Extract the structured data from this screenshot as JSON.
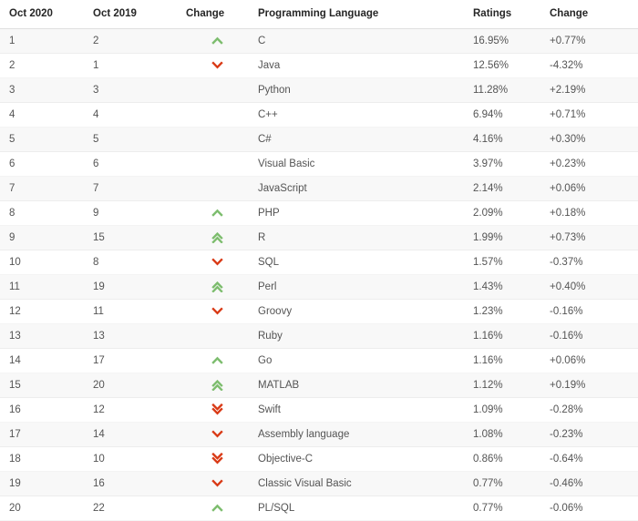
{
  "table": {
    "columns": [
      {
        "key": "rank_new",
        "label": "Oct 2020"
      },
      {
        "key": "rank_old",
        "label": "Oct 2019"
      },
      {
        "key": "change",
        "label": "Change"
      },
      {
        "key": "language",
        "label": "Programming Language"
      },
      {
        "key": "ratings",
        "label": "Ratings"
      },
      {
        "key": "delta",
        "label": "Change"
      }
    ],
    "colors": {
      "up": "#7dbd6e",
      "down": "#d93a16",
      "row_odd": "#f8f8f8",
      "row_even": "#ffffff",
      "header_text": "#262626",
      "body_text": "#545454",
      "border": "#e0e0e0"
    },
    "rows": [
      {
        "rank_new": "1",
        "rank_old": "2",
        "change": "up",
        "language": "C",
        "ratings": "16.95%",
        "delta": "+0.77%"
      },
      {
        "rank_new": "2",
        "rank_old": "1",
        "change": "down",
        "language": "Java",
        "ratings": "12.56%",
        "delta": "-4.32%"
      },
      {
        "rank_new": "3",
        "rank_old": "3",
        "change": "none",
        "language": "Python",
        "ratings": "11.28%",
        "delta": "+2.19%"
      },
      {
        "rank_new": "4",
        "rank_old": "4",
        "change": "none",
        "language": "C++",
        "ratings": "6.94%",
        "delta": "+0.71%"
      },
      {
        "rank_new": "5",
        "rank_old": "5",
        "change": "none",
        "language": "C#",
        "ratings": "4.16%",
        "delta": "+0.30%"
      },
      {
        "rank_new": "6",
        "rank_old": "6",
        "change": "none",
        "language": "Visual Basic",
        "ratings": "3.97%",
        "delta": "+0.23%"
      },
      {
        "rank_new": "7",
        "rank_old": "7",
        "change": "none",
        "language": "JavaScript",
        "ratings": "2.14%",
        "delta": "+0.06%"
      },
      {
        "rank_new": "8",
        "rank_old": "9",
        "change": "up",
        "language": "PHP",
        "ratings": "2.09%",
        "delta": "+0.18%"
      },
      {
        "rank_new": "9",
        "rank_old": "15",
        "change": "up-double",
        "language": "R",
        "ratings": "1.99%",
        "delta": "+0.73%"
      },
      {
        "rank_new": "10",
        "rank_old": "8",
        "change": "down",
        "language": "SQL",
        "ratings": "1.57%",
        "delta": "-0.37%"
      },
      {
        "rank_new": "11",
        "rank_old": "19",
        "change": "up-double",
        "language": "Perl",
        "ratings": "1.43%",
        "delta": "+0.40%"
      },
      {
        "rank_new": "12",
        "rank_old": "11",
        "change": "down",
        "language": "Groovy",
        "ratings": "1.23%",
        "delta": "-0.16%"
      },
      {
        "rank_new": "13",
        "rank_old": "13",
        "change": "none",
        "language": "Ruby",
        "ratings": "1.16%",
        "delta": "-0.16%"
      },
      {
        "rank_new": "14",
        "rank_old": "17",
        "change": "up",
        "language": "Go",
        "ratings": "1.16%",
        "delta": "+0.06%"
      },
      {
        "rank_new": "15",
        "rank_old": "20",
        "change": "up-double",
        "language": "MATLAB",
        "ratings": "1.12%",
        "delta": "+0.19%"
      },
      {
        "rank_new": "16",
        "rank_old": "12",
        "change": "down-double",
        "language": "Swift",
        "ratings": "1.09%",
        "delta": "-0.28%"
      },
      {
        "rank_new": "17",
        "rank_old": "14",
        "change": "down",
        "language": "Assembly language",
        "ratings": "1.08%",
        "delta": "-0.23%"
      },
      {
        "rank_new": "18",
        "rank_old": "10",
        "change": "down-double",
        "language": "Objective-C",
        "ratings": "0.86%",
        "delta": "-0.64%"
      },
      {
        "rank_new": "19",
        "rank_old": "16",
        "change": "down",
        "language": "Classic Visual Basic",
        "ratings": "0.77%",
        "delta": "-0.46%"
      },
      {
        "rank_new": "20",
        "rank_old": "22",
        "change": "up",
        "language": "PL/SQL",
        "ratings": "0.77%",
        "delta": "-0.06%"
      }
    ]
  }
}
